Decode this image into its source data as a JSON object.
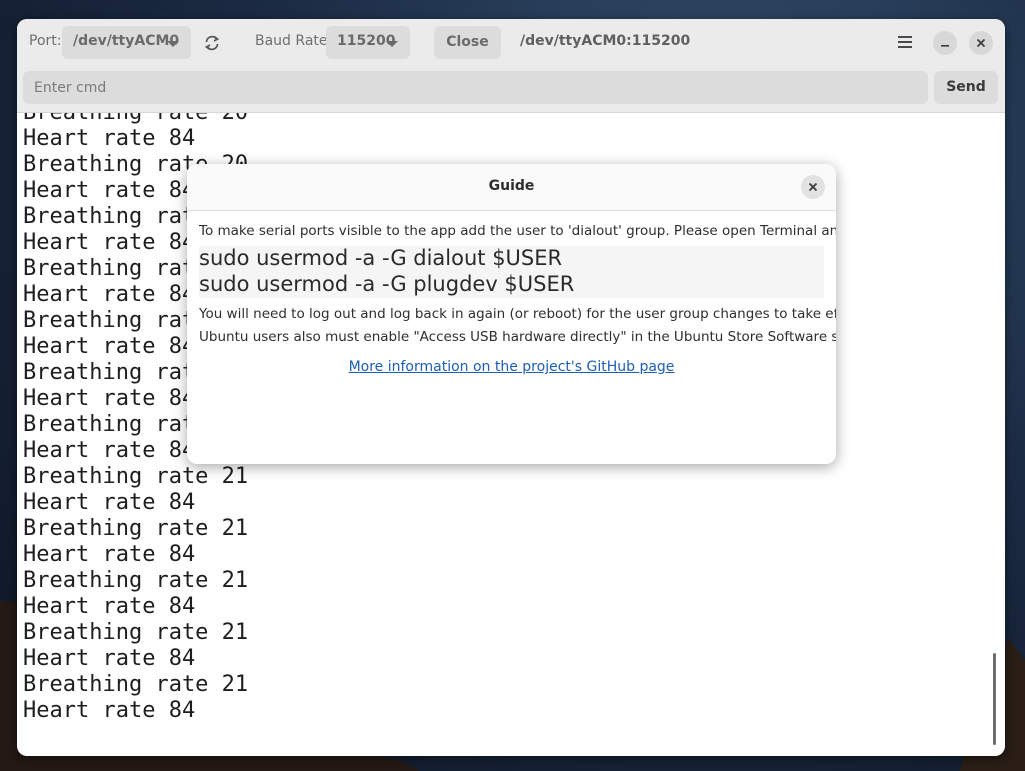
{
  "header": {
    "port_label": "Port:",
    "port_value": "/dev/ttyACM0",
    "baud_label": "Baud Rate:",
    "baud_value": "115200",
    "close_label": "Close",
    "status": "/dev/ttyACM0:115200",
    "icons": [
      "refresh-icon",
      "hamburger-menu-icon",
      "minimize-icon",
      "close-icon"
    ]
  },
  "cmd": {
    "placeholder": "Enter cmd",
    "send_label": "Send"
  },
  "terminal": {
    "lines": [
      "Breathing rate 20",
      "Heart rate 84",
      "Breathing rate 20",
      "Heart rate 84",
      "Breathing rate 21",
      "Heart rate 84",
      "Breathing rate 21",
      "Heart rate 84",
      "Breathing rate 21",
      "Heart rate 84",
      "Breathing rate 21",
      "Heart rate 84",
      "Breathing rate 21",
      "Heart rate 84",
      "Breathing rate 21",
      "Heart rate 84",
      "Breathing rate 21",
      "Heart rate 84",
      "Breathing rate 21",
      "Heart rate 84",
      "Breathing rate 21",
      "Heart rate 84",
      "Breathing rate 21",
      "Heart rate 84"
    ]
  },
  "dialog": {
    "title": "Guide",
    "intro": "To make serial ports visible to the app add the user to 'dialout' group. Please open Terminal and type:",
    "code_lines": [
      "sudo usermod -a -G dialout $USER",
      "sudo usermod -a -G plugdev $USER"
    ],
    "note1": "You will need to log out and log back in again (or reboot) for the user group changes to take effect.",
    "note2": "Ubuntu users also must enable \"Access USB hardware directly\" in the Ubuntu Store Software store.",
    "link": "More information on the project's GitHub page"
  },
  "colors": {
    "headerbar": "#ebebeb",
    "button": "#dcdcdc",
    "link": "#1c5fb4"
  }
}
